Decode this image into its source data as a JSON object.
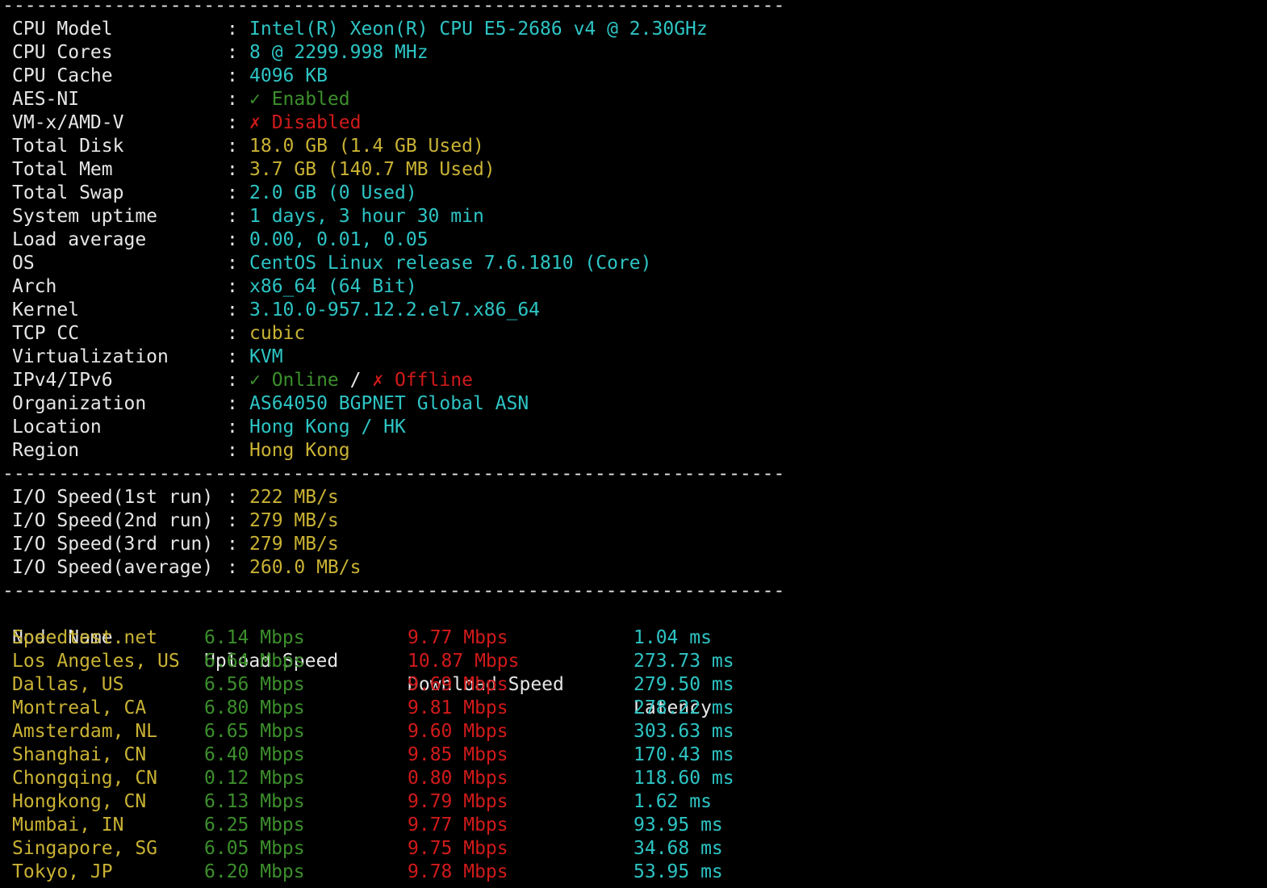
{
  "separator": "----------------------------------------------------------------------",
  "colon": ":",
  "system_info": [
    {
      "label": "CPU Model",
      "value": "Intel(R) Xeon(R) CPU E5-2686 v4 @ 2.30GHz",
      "color": "cyan"
    },
    {
      "label": "CPU Cores",
      "value": "8 @ 2299.998 MHz",
      "color": "cyan"
    },
    {
      "label": "CPU Cache",
      "value": "4096 KB",
      "color": "cyan"
    },
    {
      "label": "AES-NI",
      "value": "✓ Enabled",
      "color": "green"
    },
    {
      "label": "VM-x/AMD-V",
      "value": "✗ Disabled",
      "color": "red"
    },
    {
      "label": "Total Disk",
      "value": "18.0 GB (1.4 GB Used)",
      "color": "yellow",
      "value_used": "(1.4 GB Used)"
    },
    {
      "label": "Total Mem",
      "value": "3.7 GB (140.7 MB Used)",
      "color": "yellow"
    },
    {
      "label": "Total Swap",
      "value": "2.0 GB (0 Used)",
      "color": "cyan"
    },
    {
      "label": "System uptime",
      "value": "1 days, 3 hour 30 min",
      "color": "cyan"
    },
    {
      "label": "Load average",
      "value": "0.00, 0.01, 0.05",
      "color": "cyan"
    },
    {
      "label": "OS",
      "value": "CentOS Linux release 7.6.1810 (Core)",
      "color": "cyan"
    },
    {
      "label": "Arch",
      "value": "x86_64 (64 Bit)",
      "color": "cyan"
    },
    {
      "label": "Kernel",
      "value": "3.10.0-957.12.2.el7.x86_64",
      "color": "cyan"
    },
    {
      "label": "TCP CC",
      "value": "cubic",
      "color": "yellow"
    },
    {
      "label": "Virtualization",
      "value": "KVM",
      "color": "cyan"
    },
    {
      "label": "IPv4/IPv6",
      "ipv4": "✓ Online",
      "slash": " / ",
      "ipv6": "✗ Offline"
    },
    {
      "label": "Organization",
      "value": "AS64050 BGPNET Global ASN",
      "color": "cyan"
    },
    {
      "label": "Location",
      "value": "Hong Kong / HK",
      "color": "cyan"
    },
    {
      "label": "Region",
      "value": "Hong Kong",
      "color": "yellow"
    }
  ],
  "io_speed": [
    {
      "label": "I/O Speed(1st run)",
      "value": "222 MB/s"
    },
    {
      "label": "I/O Speed(2nd run)",
      "value": "279 MB/s"
    },
    {
      "label": "I/O Speed(3rd run)",
      "value": "279 MB/s"
    },
    {
      "label": "I/O Speed(average)",
      "value": "260.0 MB/s"
    }
  ],
  "speedtest": {
    "headers": [
      "Node Name",
      "Upload Speed",
      "Download Speed",
      "Latency"
    ],
    "rows": [
      {
        "node": "Speedtest.net",
        "upload": "6.14 Mbps",
        "download": "9.77 Mbps",
        "latency": "1.04 ms"
      },
      {
        "node": "Los Angeles, US",
        "upload": "6.64 Mbps",
        "download": "10.87 Mbps",
        "latency": "273.73 ms"
      },
      {
        "node": "Dallas, US",
        "upload": "6.56 Mbps",
        "download": "9.69 Mbps",
        "latency": "279.50 ms"
      },
      {
        "node": "Montreal, CA",
        "upload": "6.80 Mbps",
        "download": "9.81 Mbps",
        "latency": "278.22 ms"
      },
      {
        "node": "Amsterdam, NL",
        "upload": "6.65 Mbps",
        "download": "9.60 Mbps",
        "latency": "303.63 ms"
      },
      {
        "node": "Shanghai, CN",
        "upload": "6.40 Mbps",
        "download": "9.85 Mbps",
        "latency": "170.43 ms"
      },
      {
        "node": "Chongqing, CN",
        "upload": "0.12 Mbps",
        "download": "0.80 Mbps",
        "latency": "118.60 ms"
      },
      {
        "node": "Hongkong, CN",
        "upload": "6.13 Mbps",
        "download": "9.79 Mbps",
        "latency": "1.62 ms"
      },
      {
        "node": "Mumbai, IN",
        "upload": "6.25 Mbps",
        "download": "9.77 Mbps",
        "latency": "93.95 ms"
      },
      {
        "node": "Singapore, SG",
        "upload": "6.05 Mbps",
        "download": "9.75 Mbps",
        "latency": "34.68 ms"
      },
      {
        "node": "Tokyo, JP",
        "upload": "6.20 Mbps",
        "download": "9.78 Mbps",
        "latency": "53.95 ms"
      }
    ]
  },
  "colors": {
    "background": "#000000",
    "label": "#e6e6e6",
    "cyan": "#2ec4c4",
    "yellow": "#c9b234",
    "green": "#3c8f2c",
    "red": "#d11a1a"
  }
}
